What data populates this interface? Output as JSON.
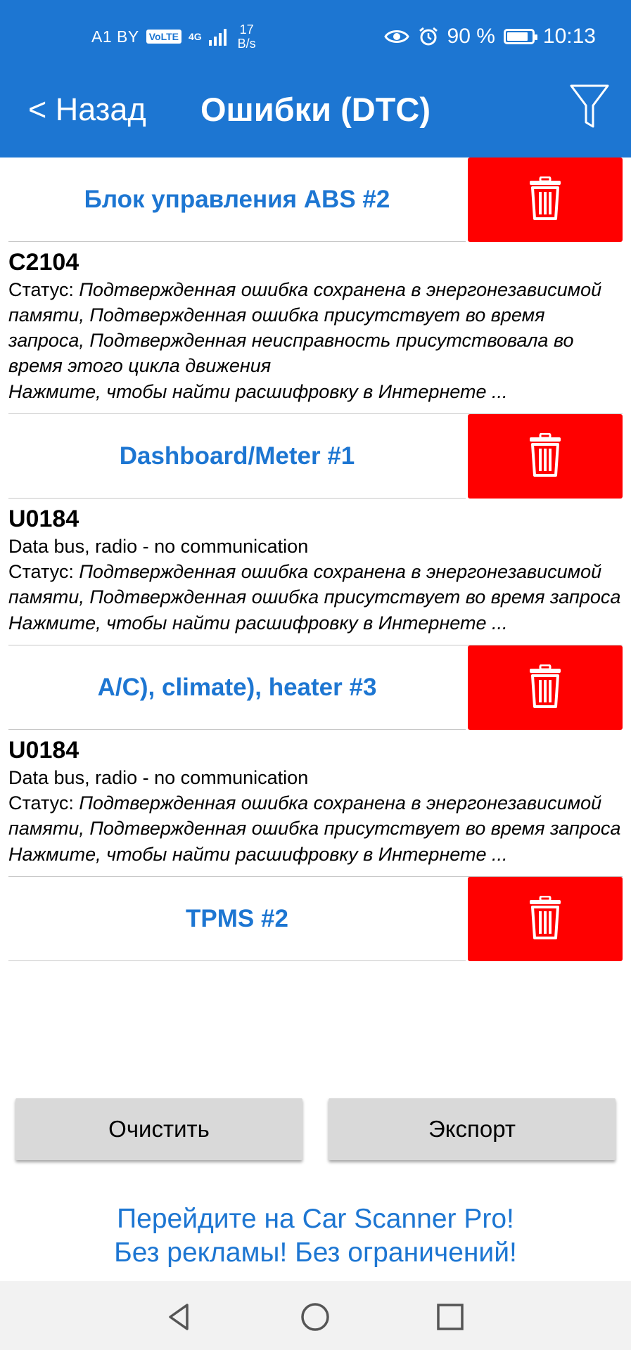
{
  "status_bar": {
    "carrier": "A1 BY",
    "volte": "VoLTE",
    "network": "4G",
    "speed_value": "17",
    "speed_unit": "B/s",
    "battery": "90 %",
    "battery_level": 0.9,
    "time": "10:13"
  },
  "header": {
    "back_label": "< Назад",
    "title": "Ошибки (DTC)"
  },
  "modules": [
    {
      "name": "Блок управления ABS #2",
      "dtcs": [
        {
          "code": "C2104",
          "description": "",
          "status_label": "Статус: ",
          "status_text": "Подтвержденная ошибка сохранена в энергонезависимой памяти, Подтвержденная ошибка присутствует во время запроса, Подтвержденная неисправность присутствовала во время этого цикла движения",
          "hint": "Нажмите, чтобы найти расшифровку в Интернете ..."
        }
      ]
    },
    {
      "name": "Dashboard/Meter #1",
      "dtcs": [
        {
          "code": "U0184",
          "description": "Data bus, radio - no communication",
          "status_label": "Статус: ",
          "status_text": "Подтвержденная ошибка сохранена в энергонезависимой памяти, Подтвержденная ошибка присутствует во время запроса",
          "hint": "Нажмите, чтобы найти расшифровку в Интернете ..."
        }
      ]
    },
    {
      "name": "A/C), climate), heater #3",
      "dtcs": [
        {
          "code": "U0184",
          "description": "Data bus, radio - no communication",
          "status_label": "Статус: ",
          "status_text": "Подтвержденная ошибка сохранена в энергонезависимой памяти, Подтвержденная ошибка присутствует во время запроса",
          "hint": "Нажмите, чтобы найти расшифровку в Интернете ..."
        }
      ]
    },
    {
      "name": "TPMS #2",
      "dtcs": []
    }
  ],
  "actions": {
    "clear_label": "Очистить",
    "export_label": "Экспорт"
  },
  "promo": {
    "line1": "Перейдите на Car Scanner Pro!",
    "line2": "Без рекламы! Без ограничений!"
  },
  "icons": {
    "back": "chevron-left",
    "filter": "filter-icon",
    "delete": "trash-icon",
    "nav_back": "triangle-back-icon",
    "nav_home": "circle-home-icon",
    "nav_recents": "square-recents-icon"
  },
  "colors": {
    "header": "#1d76d2",
    "accent_text": "#1d76d2",
    "delete": "#ff0000",
    "button_bg": "#d9d9d9"
  }
}
